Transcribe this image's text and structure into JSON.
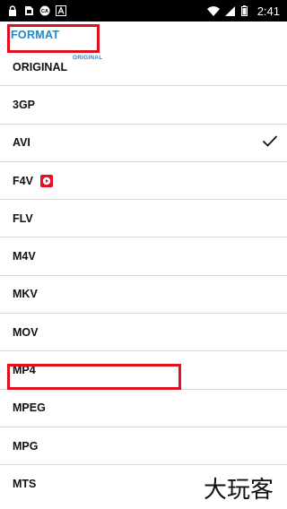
{
  "status_bar": {
    "time": "2:41",
    "left_icons": [
      "lock-icon",
      "sim-card-icon",
      "app-badge-icon",
      "font-icon"
    ],
    "right_icons": [
      "wifi-icon",
      "signal-icon",
      "battery-icon"
    ]
  },
  "header": {
    "title": "FORMAT",
    "subtitle": "ORIGINAL",
    "accent_color": "#1e88c8"
  },
  "formats": [
    {
      "label": "ORIGINAL"
    },
    {
      "label": "3GP"
    },
    {
      "label": "AVI",
      "selected": true
    },
    {
      "label": "F4V",
      "badge": "play-badge-icon"
    },
    {
      "label": "FLV"
    },
    {
      "label": "M4V"
    },
    {
      "label": "MKV"
    },
    {
      "label": "MOV"
    },
    {
      "label": "MP4"
    },
    {
      "label": "MPEG"
    },
    {
      "label": "MPG"
    },
    {
      "label": "MTS"
    }
  ],
  "highlight_color": "#e0101e",
  "watermark": "大玩客"
}
